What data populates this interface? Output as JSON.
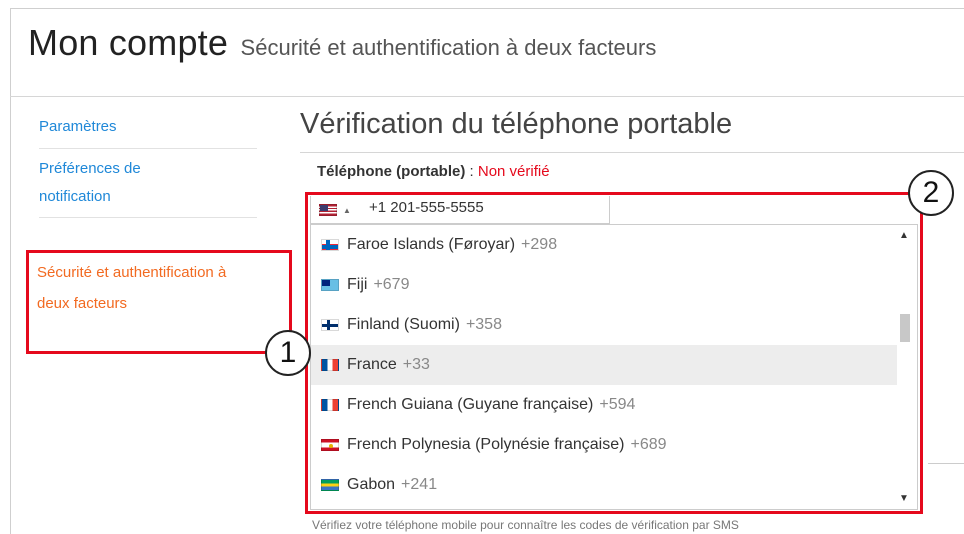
{
  "header": {
    "title": "Mon compte",
    "subtitle": "Sécurité et authentification à deux facteurs"
  },
  "sidebar": {
    "items": [
      {
        "label": "Paramètres"
      },
      {
        "label": "Préférences de notification"
      },
      {
        "label": "Sécurité et authentification à deux facteurs",
        "active": true
      }
    ]
  },
  "main": {
    "title": "Vérification du téléphone portable",
    "phone_label": "Téléphone (portable)",
    "phone_label_sep": " : ",
    "phone_status": "Non vérifié",
    "phone_value": "+1 201-555-5555",
    "selected_country_flag": "us-flag-icon",
    "helper_text": "Vérifiez votre téléphone mobile pour connaître les codes de vérification par SMS"
  },
  "dropdown": {
    "options": [
      {
        "name": "Faroe Islands (Føroyar)",
        "dial": "+298",
        "flag": "fo"
      },
      {
        "name": "Fiji",
        "dial": "+679",
        "flag": "fj"
      },
      {
        "name": "Finland (Suomi)",
        "dial": "+358",
        "flag": "fi"
      },
      {
        "name": "France",
        "dial": "+33",
        "flag": "fr",
        "highlighted": true
      },
      {
        "name": "French Guiana (Guyane française)",
        "dial": "+594",
        "flag": "gf"
      },
      {
        "name": "French Polynesia (Polynésie française)",
        "dial": "+689",
        "flag": "pf"
      },
      {
        "name": "Gabon",
        "dial": "+241",
        "flag": "ga"
      }
    ]
  },
  "annotations": {
    "marker1": "1",
    "marker2": "2"
  },
  "colors": {
    "accent_link": "#1f88d8",
    "active_link": "#f26a21",
    "annotation_red": "#e5091c",
    "status_red": "#e5091c"
  }
}
